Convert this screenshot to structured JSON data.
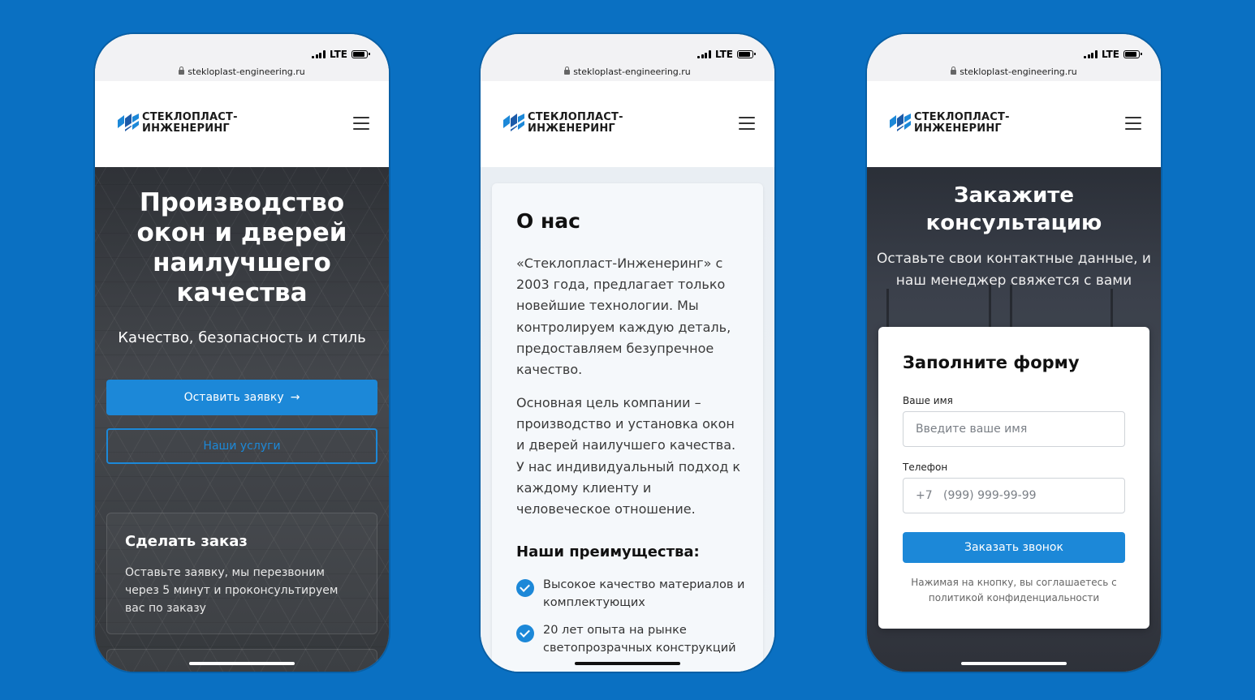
{
  "browser": {
    "network": "LTE",
    "url": "stekloplast-engineering.ru"
  },
  "brand": {
    "line1": "СТЕКЛОПЛАСТ-",
    "line2": "ИНЖЕНЕРИНГ",
    "accent": "#1c88d8",
    "background": "#0a70c2"
  },
  "home": {
    "title": "Производство окон и дверей наилучшего качества",
    "subtitle": "Качество, безопасность и стиль",
    "primary_button": "Оставить заявку",
    "secondary_button": "Наши услуги",
    "order_card": {
      "title": "Сделать заказ",
      "text": "Оставьте заявку, мы перезвоним через 5 минут и проконсультируем вас по заказу"
    }
  },
  "about": {
    "title": "О нас",
    "paragraph1": "«Стеклопласт-Инженеринг» с 2003 года, предлагает только новейшие технологии. Мы контролируем каждую деталь, предоставляем безупречное качество.",
    "paragraph2": "Основная цель компании – производство и установка окон и дверей наилучшего качества. У нас индивидуальный подход к каждому клиенту и человеческое отношение.",
    "advantages_title": "Наши преимущества:",
    "advantages": [
      "Высокое качество материалов и комплектующих",
      "20 лет опыта на рынке светопрозрачных конструкций"
    ]
  },
  "consult": {
    "title": "Закажите консультацию",
    "subtitle": "Оставьте свои контактные данные, и наш менеджер свяжется с вами",
    "form": {
      "title": "Заполните форму",
      "name_label": "Ваше имя",
      "name_placeholder": "Введите ваше имя",
      "phone_label": "Телефон",
      "phone_placeholder": "+7   (999) 999-99-99",
      "submit": "Заказать звонок",
      "note": "Нажимая на кнопку, вы соглашаетесь с политикой конфиденциальности"
    }
  }
}
